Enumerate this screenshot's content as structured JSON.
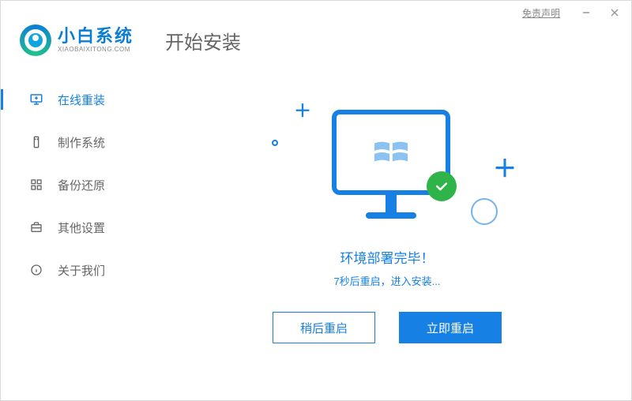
{
  "titlebar": {
    "disclaimer": "免责声明"
  },
  "brand": {
    "name": "小白系统",
    "url": "XIAOBAIXITONG.COM"
  },
  "page": {
    "title": "开始安装"
  },
  "sidebar": {
    "items": [
      {
        "label": "在线重装",
        "active": true
      },
      {
        "label": "制作系统",
        "active": false
      },
      {
        "label": "备份还原",
        "active": false
      },
      {
        "label": "其他设置",
        "active": false
      },
      {
        "label": "关于我们",
        "active": false
      }
    ]
  },
  "main": {
    "status_title": "环境部署完毕！",
    "status_sub": "7秒后重启，进入安装...",
    "later_btn": "稍后重启",
    "now_btn": "立即重启"
  }
}
